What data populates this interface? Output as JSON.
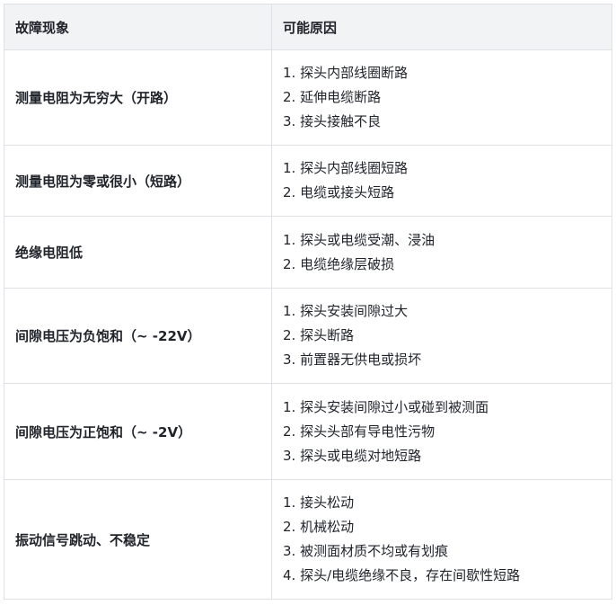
{
  "table": {
    "headers": [
      "故障现象",
      "可能原因"
    ],
    "rows": [
      {
        "symptom": "测量电阻为无穷大（开路）",
        "causes": [
          "1. 探头内部线圈断路",
          "2. 延伸电缆断路",
          "3. 接头接触不良"
        ]
      },
      {
        "symptom": "测量电阻为零或很小（短路）",
        "causes": [
          "1. 探头内部线圈短路",
          "2. 电缆或接头短路"
        ]
      },
      {
        "symptom": "绝缘电阻低",
        "causes": [
          "1. 探头或电缆受潮、浸油",
          "2. 电缆绝缘层破损"
        ]
      },
      {
        "symptom": "间隙电压为负饱和（~ -22V）",
        "causes": [
          "1. 探头安装间隙过大",
          "2. 探头断路",
          "3. 前置器无供电或损坏"
        ]
      },
      {
        "symptom": "间隙电压为正饱和（~ -2V）",
        "causes": [
          "1. 探头安装间隙过小或碰到被测面",
          "2. 探头头部有导电性污物",
          "3. 探头或电缆对地短路"
        ]
      },
      {
        "symptom": "振动信号跳动、不稳定",
        "causes": [
          "1. 接头松动",
          "2. 机械松动",
          "3. 被测面材质不均或有划痕",
          "4. 探头/电缆绝缘不良，存在间歇性短路"
        ]
      }
    ]
  }
}
